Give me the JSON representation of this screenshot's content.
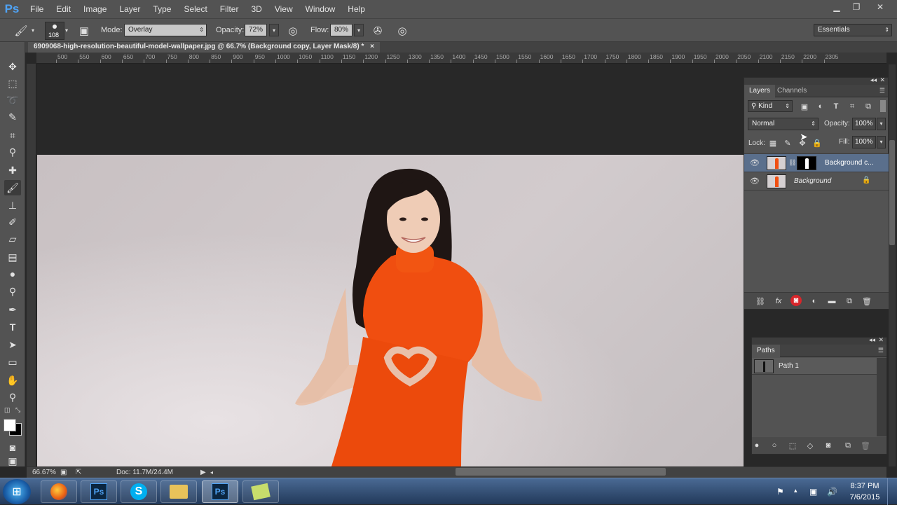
{
  "app": {
    "logo": "Ps"
  },
  "menu": [
    "File",
    "Edit",
    "Image",
    "Layer",
    "Type",
    "Select",
    "Filter",
    "3D",
    "View",
    "Window",
    "Help"
  ],
  "window_controls": {
    "minimize": "▁",
    "restore": "❐",
    "close": "✕"
  },
  "options": {
    "brush_size": "108",
    "mode_label": "Mode:",
    "mode_value": "Overlay",
    "opacity_label": "Opacity:",
    "opacity_value": "72%",
    "flow_label": "Flow:",
    "flow_value": "80%",
    "workspace": "Essentials"
  },
  "document": {
    "tab_title": "6909068-high-resolution-beautiful-model-wallpaper.jpg @ 66.7% (Background copy, Layer Mask/8) *",
    "tab_close": "×"
  },
  "ruler_top": [
    "500",
    "550",
    "600",
    "650",
    "700",
    "750",
    "800",
    "850",
    "900",
    "950",
    "1000",
    "1050",
    "1100",
    "1150",
    "1200",
    "1250",
    "1300",
    "1350",
    "1400",
    "1450",
    "1500",
    "1550",
    "1600",
    "1650",
    "1700",
    "1750",
    "1800",
    "1850",
    "1900",
    "1950",
    "2000",
    "2050",
    "2100",
    "2150",
    "2200",
    "2305"
  ],
  "status": {
    "zoom": "66.67%",
    "doc": "Doc: 11.7M/24.4M"
  },
  "layers_panel": {
    "tabs": [
      "Layers",
      "Channels"
    ],
    "filter_kind": "Kind",
    "blend_mode": "Normal",
    "opacity_label": "Opacity:",
    "opacity_value": "100%",
    "lock_label": "Lock:",
    "fill_label": "Fill:",
    "fill_value": "100%",
    "layers": [
      {
        "name": "Background c...",
        "selected": true,
        "has_mask": true
      },
      {
        "name": "Background",
        "selected": false,
        "locked": true
      }
    ]
  },
  "paths_panel": {
    "tab": "Paths",
    "paths": [
      {
        "name": "Path 1"
      }
    ]
  },
  "taskbar": {
    "apps": [
      "firefox-icon",
      "photoshop-icon",
      "skype-icon",
      "explorer-icon",
      "photoshop-active-icon",
      "notes-icon"
    ],
    "clock_time": "8:37 PM",
    "clock_date": "7/6/2015"
  },
  "colors": {
    "dress": "#f04e10",
    "accent_blue": "#4fa3f5",
    "selected_layer": "#5a6f8c"
  }
}
